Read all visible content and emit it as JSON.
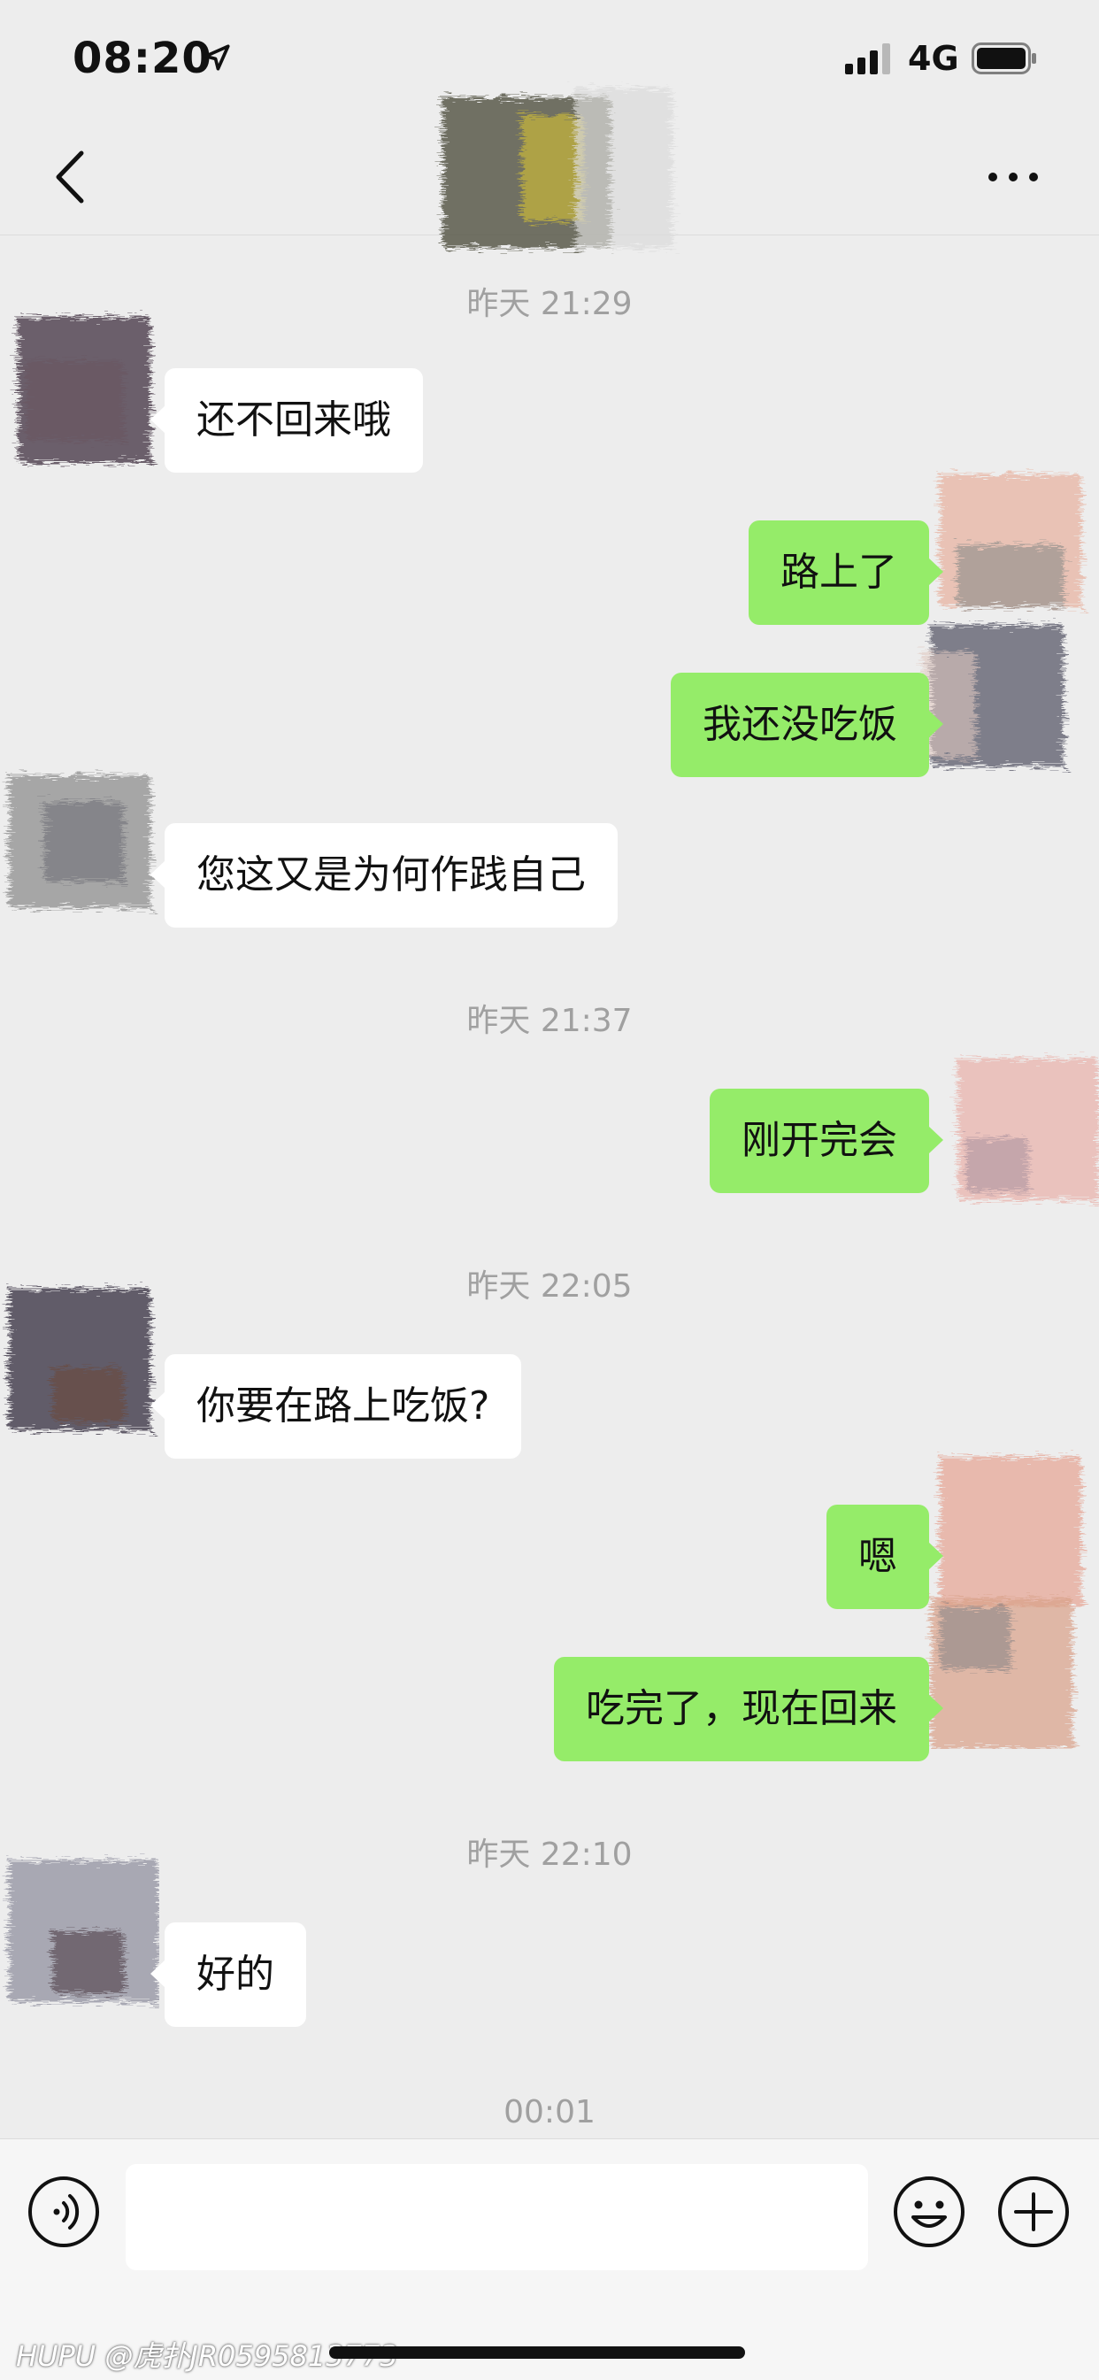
{
  "status_bar": {
    "time": "08:20",
    "network": "4G"
  },
  "navbar": {
    "back_icon": "chevron-left-icon",
    "more_icon": "ellipsis-icon"
  },
  "messages": [
    {
      "kind": "time",
      "text": "昨天 21:29"
    },
    {
      "kind": "msg",
      "side": "in",
      "text": "还不回来哦"
    },
    {
      "kind": "msg",
      "side": "out",
      "text": "路上了"
    },
    {
      "kind": "msg",
      "side": "out",
      "text": "我还没吃饭"
    },
    {
      "kind": "msg",
      "side": "in",
      "text": "您这又是为何作践自己"
    },
    {
      "kind": "time",
      "text": "昨天 21:37"
    },
    {
      "kind": "msg",
      "side": "out",
      "text": "刚开完会"
    },
    {
      "kind": "time",
      "text": "昨天 22:05"
    },
    {
      "kind": "msg",
      "side": "in",
      "text": "你要在路上吃饭?"
    },
    {
      "kind": "msg",
      "side": "out",
      "text": "嗯"
    },
    {
      "kind": "msg",
      "side": "out",
      "text": "吃完了，现在回来"
    },
    {
      "kind": "time",
      "text": "昨天 22:10"
    },
    {
      "kind": "msg",
      "side": "in",
      "text": "好的"
    },
    {
      "kind": "time",
      "text": "00:01"
    }
  ],
  "input_bar": {
    "voice_icon": "voice-icon",
    "emoji_icon": "emoji-icon",
    "plus_icon": "plus-icon",
    "text_value": ""
  },
  "watermark": "HUPU @虎扑JR0595813773",
  "colors": {
    "background": "#ededed",
    "outgoing_bubble": "#95ec69",
    "incoming_bubble": "#ffffff",
    "timestamp": "#a0a0a0"
  }
}
